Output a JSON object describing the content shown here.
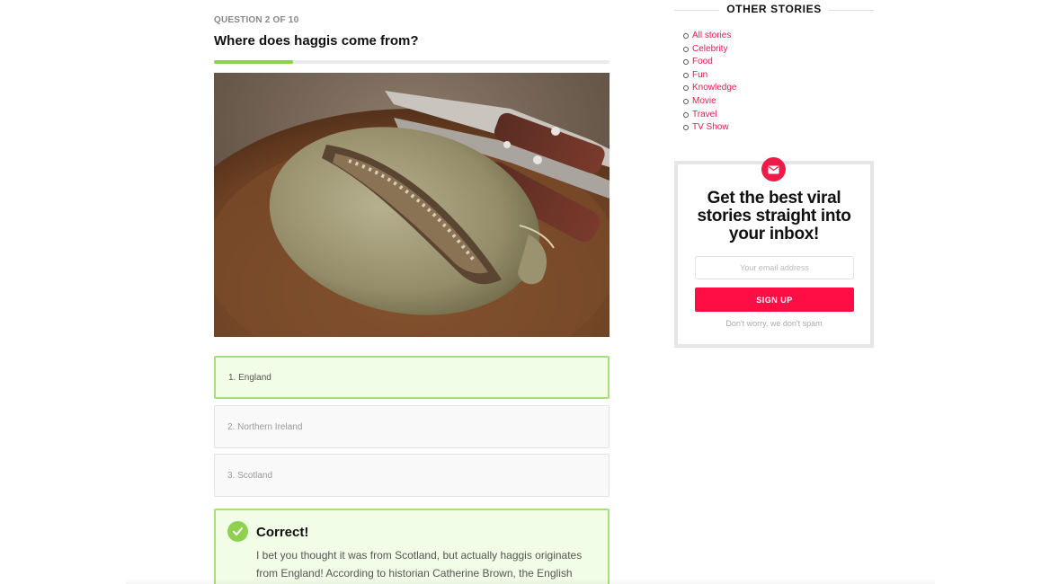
{
  "quiz": {
    "counter": "QUESTION 2 OF 10",
    "question": "Where does haggis come from?",
    "progress_fraction": 0.2,
    "image_icon": "haggis-photo",
    "answers": [
      {
        "label": "1. England",
        "state": "correct"
      },
      {
        "label": "2. Northern Ireland",
        "state": "neutral"
      },
      {
        "label": "3. Scotland",
        "state": "neutral"
      }
    ],
    "result": {
      "icon": "checkmark-icon",
      "title": "Correct!",
      "body": "I bet you thought it was from Scotland, but actually haggis originates from England! According to historian Catherine Brown, the English"
    }
  },
  "sidebar": {
    "other_stories_heading": "OTHER STORIES",
    "stories": [
      "All stories",
      "Celebrity",
      "Food",
      "Fun",
      "Knowledge",
      "Movie",
      "Travel",
      "TV Show"
    ],
    "newsletter": {
      "icon": "envelope-icon",
      "title": "Get the best viral stories straight into your inbox!",
      "email_placeholder": "Your email address",
      "button_label": "SIGN UP",
      "note": "Don't worry, we don't spam"
    }
  },
  "colors": {
    "accent": "#ff0d45",
    "link": "#e8174f",
    "success": "#8fd14f",
    "success_bg": "#f1fde6"
  }
}
